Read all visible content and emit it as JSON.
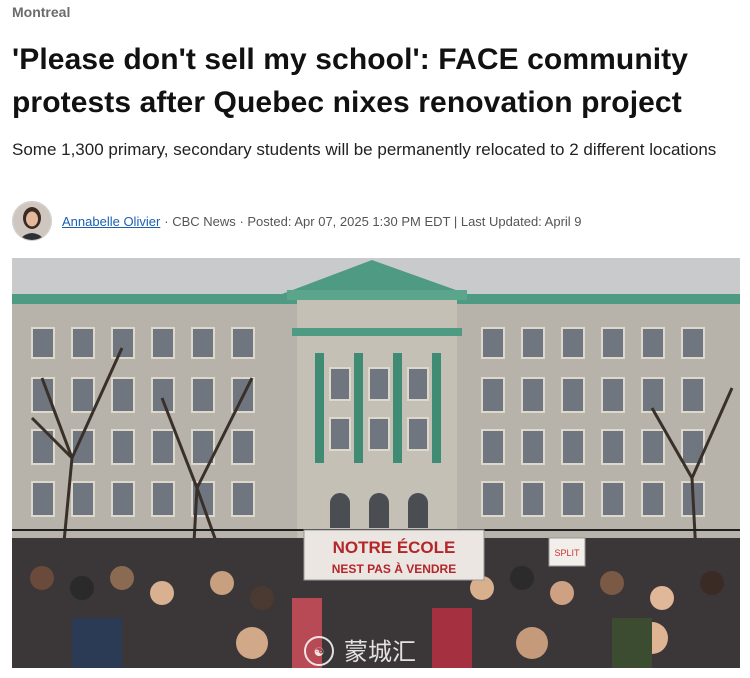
{
  "article": {
    "section": "Montreal",
    "headline_line1": "'Please don't sell my school': FACE community",
    "headline_line2": "protests after Quebec nixes renovation project",
    "dek": "Some 1,300 primary, secondary students will be permanently relocated to 2 different locations",
    "byline": {
      "author": "Annabelle Olivier",
      "sep1": " · ",
      "source": "CBC News",
      "sep2": " · ",
      "posted": "Posted: Apr 07, 2025 1:30 PM EDT",
      "sep3": " | ",
      "updated": "Last Updated: April 9"
    }
  },
  "image": {
    "banner_line1": "NOTRE ÉCOLE",
    "banner_line2": "NEST PAS À VENDRE",
    "sign_text": "SPLIT",
    "watermark_text": "蒙城汇"
  },
  "colors": {
    "section": "#6b6b6b",
    "link": "#1a5fb4",
    "banner_red": "#b3262a",
    "copper_roof": "#4f9a82"
  }
}
